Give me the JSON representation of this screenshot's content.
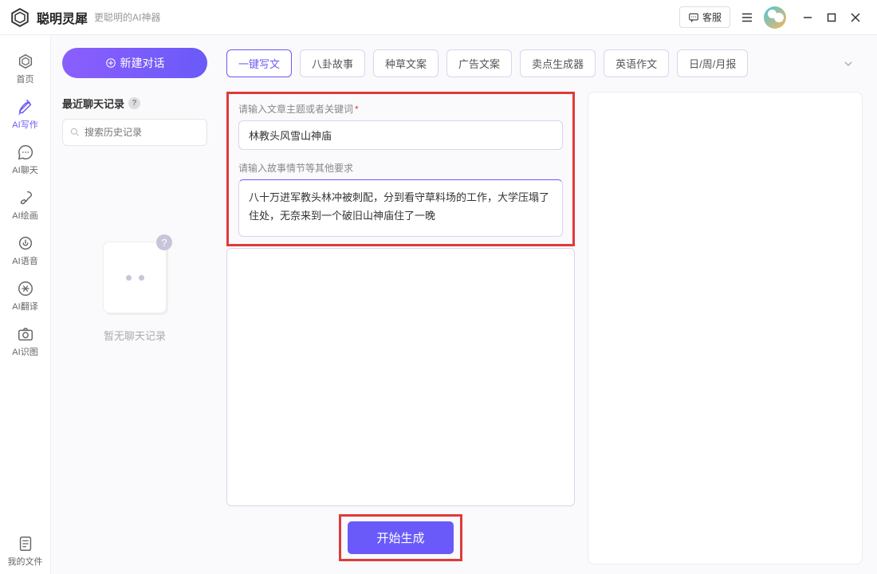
{
  "titlebar": {
    "app_name": "聪明灵犀",
    "tagline": "更聪明的AI神器",
    "support_label": "客服"
  },
  "sidebar": {
    "items": [
      {
        "label": "首页",
        "icon": "home-hex-icon"
      },
      {
        "label": "AI写作",
        "icon": "pen-icon"
      },
      {
        "label": "AI聊天",
        "icon": "chat-icon"
      },
      {
        "label": "AI绘画",
        "icon": "brush-icon"
      },
      {
        "label": "AI语音",
        "icon": "audio-icon"
      },
      {
        "label": "AI翻译",
        "icon": "translate-icon"
      },
      {
        "label": "AI识图",
        "icon": "camera-icon"
      }
    ],
    "footer": {
      "label": "我的文件",
      "icon": "file-icon"
    }
  },
  "history": {
    "new_chat_label": "新建对话",
    "recent_title": "最近聊天记录",
    "search_placeholder": "搜索历史记录",
    "empty_text": "暂无聊天记录"
  },
  "templates": {
    "items": [
      "一键写文",
      "八卦故事",
      "种草文案",
      "广告文案",
      "卖点生成器",
      "英语作文",
      "日/周/月报"
    ],
    "active_index": 0
  },
  "form": {
    "topic_label": "请输入文章主题或者关键词",
    "topic_value": "林教头风雪山神庙",
    "details_label": "请输入故事情节等其他要求",
    "details_value": "八十万进军教头林冲被刺配，分到看守草料场的工作，大学压塌了住处，无奈来到一个破旧山神庙住了一晚",
    "generate_label": "开始生成"
  }
}
